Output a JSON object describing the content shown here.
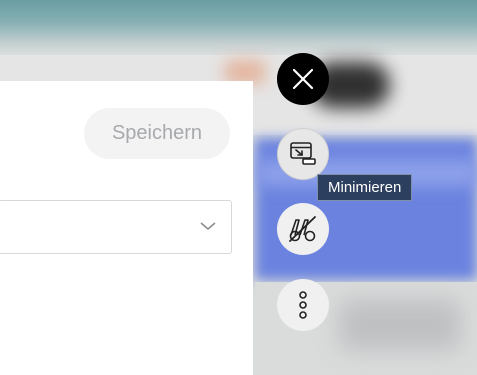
{
  "panel": {
    "save_label": "Speichern"
  },
  "controls": {
    "close_icon": "close-icon",
    "minimize_icon": "minimize-window-icon",
    "reader_icon": "reader-mode-off-icon",
    "more_icon": "more-vertical-icon"
  },
  "tooltip": {
    "text": "Minimieren"
  },
  "colors": {
    "accent_blue": "#6b83df",
    "tooltip_bg": "#2d3f5e",
    "close_bg": "#000000"
  }
}
